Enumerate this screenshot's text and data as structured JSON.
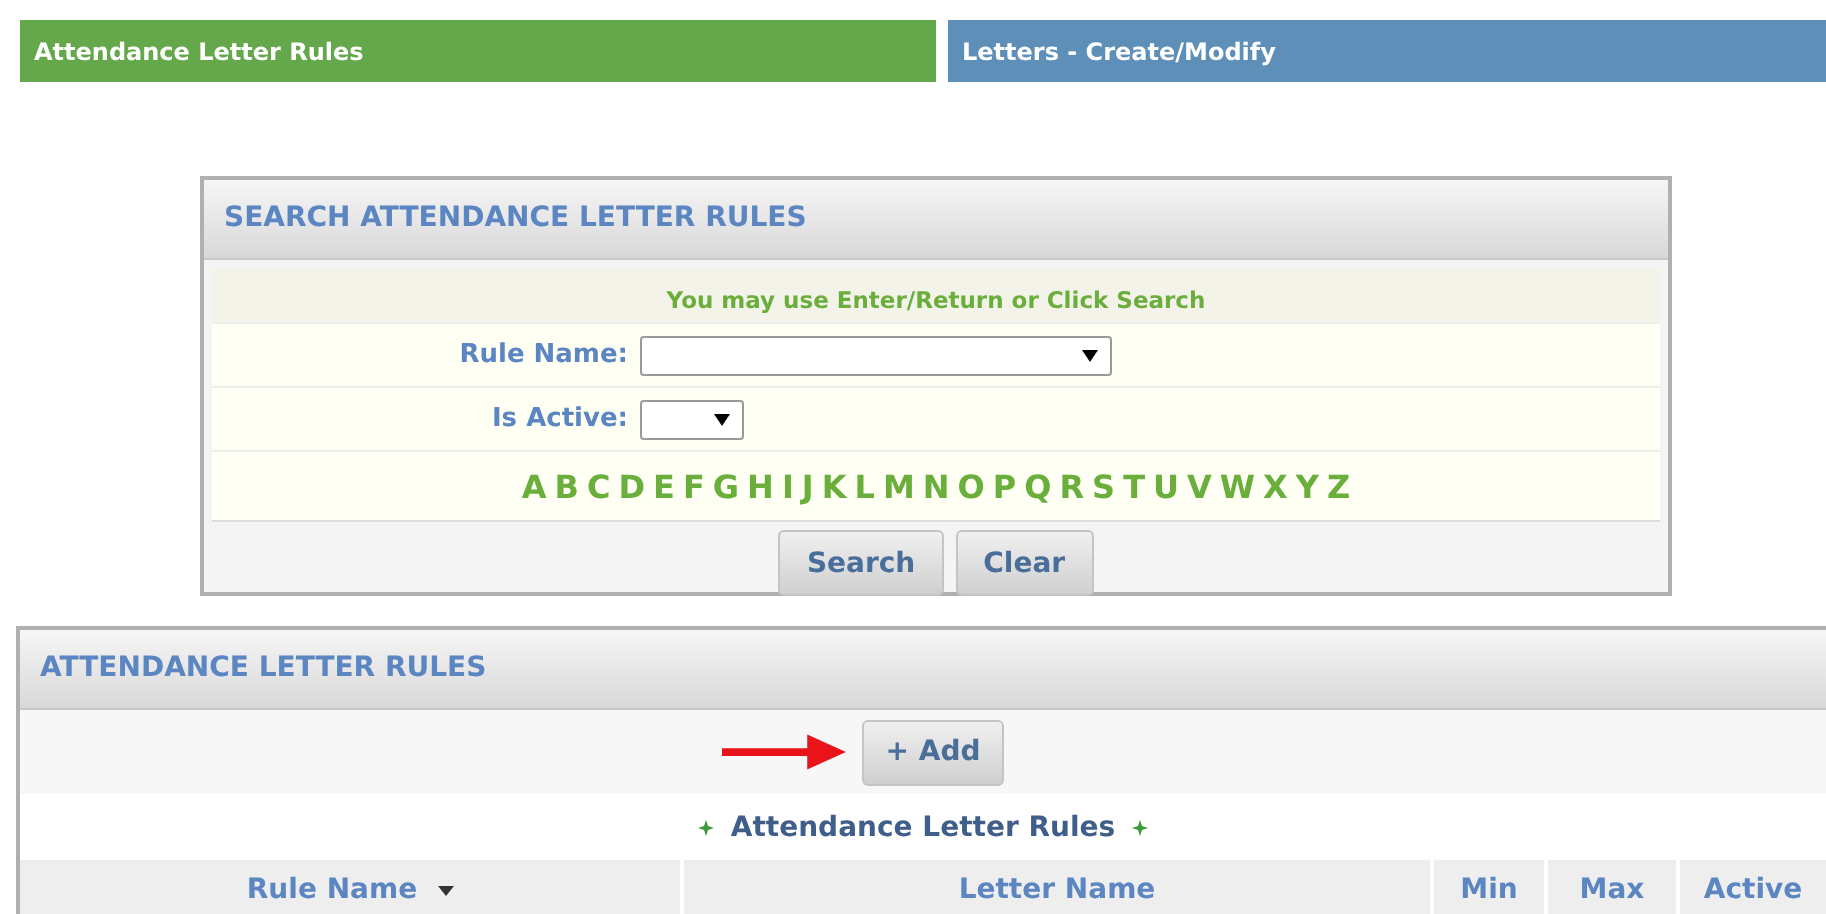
{
  "tabs": [
    {
      "label": "Attendance Letter Rules",
      "selected": true
    },
    {
      "label": "Letters - Create/Modify",
      "selected": false
    }
  ],
  "search_panel": {
    "title": "SEARCH ATTENDANCE LETTER RULES",
    "hint": "You may use Enter/Return or Click Search",
    "fields": [
      {
        "label": "Rule Name:",
        "kind": "wide"
      },
      {
        "label": "Is Active:",
        "kind": "narrow"
      }
    ],
    "letters": [
      "A",
      "B",
      "C",
      "D",
      "E",
      "F",
      "G",
      "H",
      "I",
      "J",
      "K",
      "L",
      "M",
      "N",
      "O",
      "P",
      "Q",
      "R",
      "S",
      "T",
      "U",
      "V",
      "W",
      "X",
      "Y",
      "Z"
    ],
    "buttons": [
      "Search",
      "Clear"
    ]
  },
  "rules_panel": {
    "title": "ATTENDANCE LETTER RULES",
    "add_button": "+ Add",
    "table_title": "Attendance Letter Rules",
    "columns": [
      {
        "label": "Rule Name",
        "sortable": true
      },
      {
        "label": "Letter Name",
        "sortable": false
      },
      {
        "label": "Min",
        "sortable": false
      },
      {
        "label": "Max",
        "sortable": false
      },
      {
        "label": "Active",
        "sortable": false
      }
    ]
  }
}
